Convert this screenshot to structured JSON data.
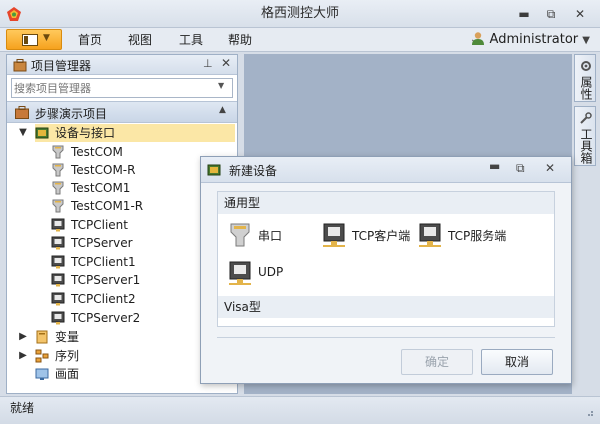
{
  "window": {
    "title": "格西测控大师",
    "minimize": "▬",
    "restore": "⧉",
    "close": "✕"
  },
  "menubar": {
    "items": [
      "首页",
      "视图",
      "工具",
      "帮助"
    ],
    "user": "Administrator",
    "collapse_glyph": "⌄"
  },
  "project_panel": {
    "title": "项目管理器",
    "search_placeholder": "搜索项目管理器",
    "section": "步骤演示项目",
    "tree": {
      "root": "设备与接口",
      "devices": [
        "TestCOM",
        "TestCOM-R",
        "TestCOM1",
        "TestCOM1-R",
        "TCPClient",
        "TCPServer",
        "TCPClient1",
        "TCPServer1",
        "TCPClient2",
        "TCPServer2"
      ],
      "others": [
        "变量",
        "序列",
        "画面"
      ]
    }
  },
  "side_tabs": [
    "属性",
    "工具箱"
  ],
  "status": "就绪",
  "dialog": {
    "title": "新建设备",
    "groups": [
      "通用型",
      "Visa型"
    ],
    "devices": [
      "串口",
      "TCP客户端",
      "TCP服务端",
      "UDP"
    ],
    "ok": "确定",
    "cancel": "取消"
  },
  "colors": {
    "accent_orange": "#f6a21e",
    "tree_selected": "#fbe7a6",
    "workspace": "#a3b2c7"
  }
}
